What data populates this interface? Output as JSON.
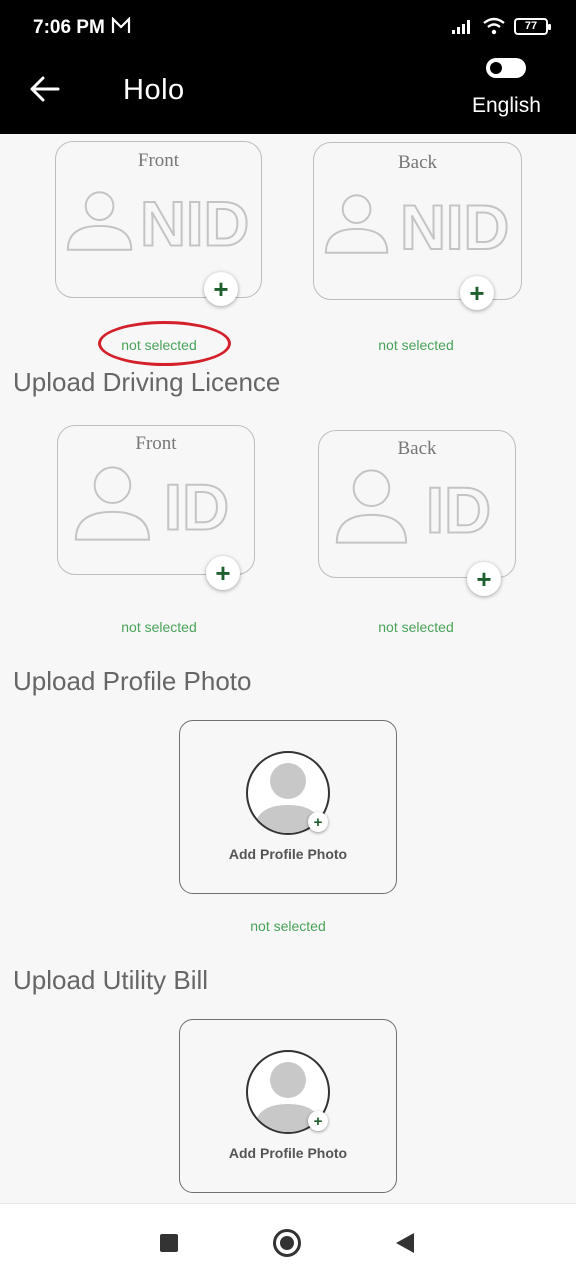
{
  "status_bar": {
    "time": "7:06 PM",
    "battery": "77"
  },
  "app_bar": {
    "title": "Holo",
    "language": "English"
  },
  "nid": {
    "front_label": "Front",
    "back_label": "Back",
    "card_text": "NID",
    "front_status": "not selected",
    "back_status": "not selected"
  },
  "driving_licence": {
    "title": "Upload Driving Licence",
    "front_label": "Front",
    "back_label": "Back",
    "card_text": "ID",
    "front_status": "not selected",
    "back_status": "not selected"
  },
  "profile_photo": {
    "title": "Upload Profile Photo",
    "add_label": "Add Profile Photo",
    "status": "not selected"
  },
  "utility_bill": {
    "title": "Upload Utility Bill",
    "add_label": "Add Profile Photo"
  },
  "colors": {
    "accent_green": "#1f5e2f",
    "status_green": "#4aa35a",
    "highlight_red": "#d4202a"
  }
}
